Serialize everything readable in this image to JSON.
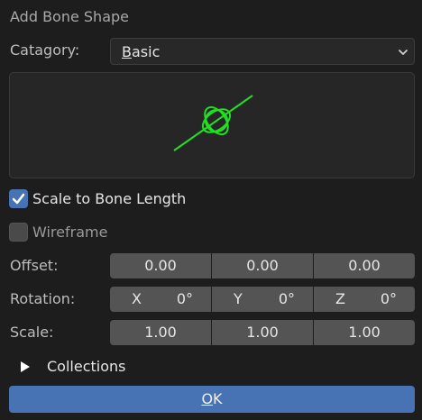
{
  "dialog": {
    "title": "Add Bone Shape",
    "category": {
      "label": "Catagory:",
      "value_first_letter": "B",
      "value_rest": "asic"
    },
    "preview": {
      "shape_color": "#22e022"
    },
    "scale_to_bone_length": {
      "label": "Scale to Bone Length",
      "checked": true
    },
    "wireframe": {
      "label": "Wireframe",
      "checked": false
    },
    "offset": {
      "label": "Offset:",
      "values": [
        "0.00",
        "0.00",
        "0.00"
      ]
    },
    "rotation": {
      "label": "Rotation:",
      "axes": [
        "X",
        "Y",
        "Z"
      ],
      "values": [
        "0°",
        "0°",
        "0°"
      ]
    },
    "scale": {
      "label": "Scale:",
      "values": [
        "1.00",
        "1.00",
        "1.00"
      ]
    },
    "collections": {
      "label": "Collections",
      "expanded": false
    },
    "ok_button": {
      "first_letter": "O",
      "rest": "K"
    },
    "colors": {
      "accent": "#4772b3",
      "field": "#545454",
      "background": "#1d1d1d"
    }
  }
}
